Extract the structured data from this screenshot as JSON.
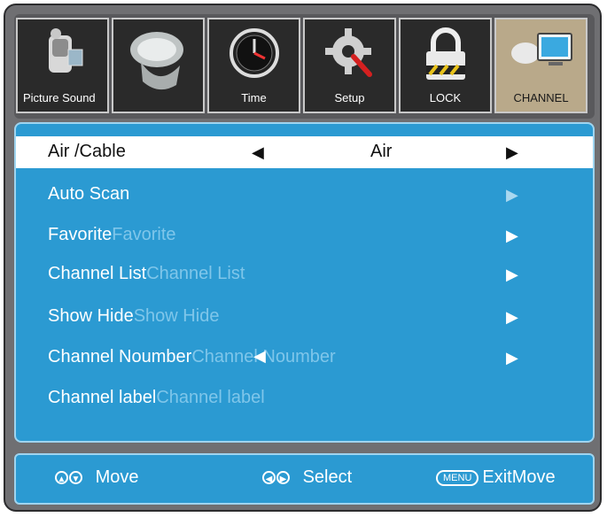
{
  "tabs": [
    {
      "label": "Picture Sound",
      "icon": "camcorder-icon"
    },
    {
      "label": "",
      "icon": "speaker-icon"
    },
    {
      "label": "Time",
      "icon": "clock-icon"
    },
    {
      "label": "Setup",
      "icon": "gear-wrench-icon"
    },
    {
      "label": "LOCK",
      "icon": "padlock-icon"
    },
    {
      "label": "CHANNEL",
      "icon": "satellite-computer-icon",
      "active": true
    }
  ],
  "menu": {
    "air_cable": {
      "name": "Air /Cable",
      "value": "Air"
    },
    "auto_scan": {
      "name": "Auto Scan"
    },
    "favorite": {
      "name": "Favorite",
      "ghost": "Favorite"
    },
    "channel_list": {
      "name": "Channel List",
      "ghost": "Channel List"
    },
    "show_hide": {
      "name": "Show Hide",
      "ghost": "Show Hide"
    },
    "channel_noumber": {
      "name": "Channel Noumber",
      "ghost": "Channel Noumber"
    },
    "channel_label": {
      "name": "Channel label",
      "ghost": "Channel label"
    }
  },
  "footer": {
    "move": {
      "glyphs": [
        "▲",
        "▼"
      ],
      "label": "Move"
    },
    "select": {
      "glyphs": [
        "◀",
        "▶"
      ],
      "label": "Select"
    },
    "exit": {
      "key": "MENU",
      "label": "ExitMove"
    }
  },
  "colors": {
    "panel": "#2b9ad2",
    "active_tab": "#b9a98a",
    "selected_row": "#ffffff"
  }
}
